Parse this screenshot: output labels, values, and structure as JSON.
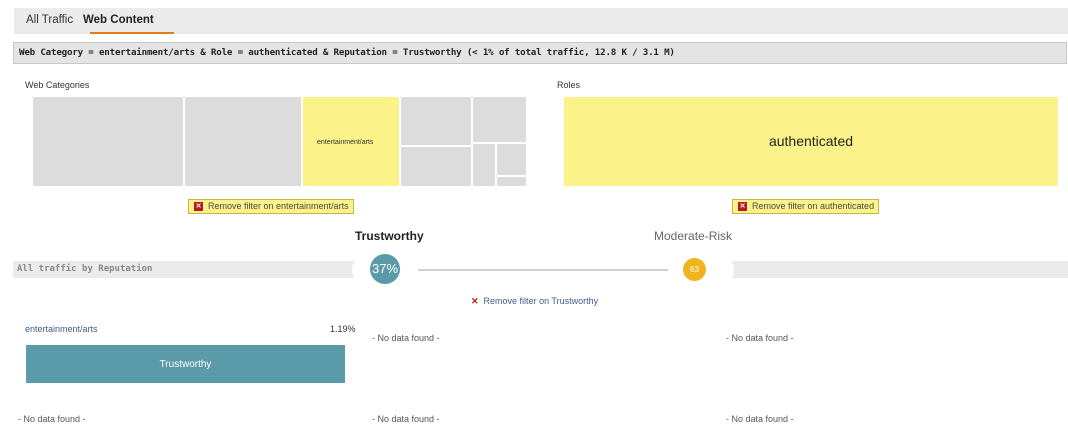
{
  "tabs": [
    {
      "label": "All Traffic",
      "active": false
    },
    {
      "label": "Web Content",
      "active": true
    }
  ],
  "filter_summary": "Web Category = entertainment/arts & Role = authenticated & Reputation = Trustworthy (< 1% of total traffic, 12.8 K / 3.1 M)",
  "web_categories": {
    "title": "Web Categories",
    "selected_label": "entertainment/arts",
    "remove_filter": "Remove filter on entertainment/arts"
  },
  "roles": {
    "title": "Roles",
    "selected_label": "authenticated",
    "remove_filter": "Remove filter on authenticated"
  },
  "reputation": {
    "band_label": "All traffic by Reputation",
    "left_title": "Trustworthy",
    "left_value": "37%",
    "right_title": "Moderate-Risk",
    "right_value": "63",
    "remove_filter": "Remove filter on Trustworthy"
  },
  "results": {
    "category_link": "entertainment/arts",
    "category_percent": "1.19%",
    "bar_label": "Trustworthy",
    "bar_fraction": 1.0,
    "no_data": "- No data found -"
  },
  "colors": {
    "accent_orange": "#e07b1f",
    "selected_yellow": "#fbf389",
    "teal": "#5b9aa9",
    "amber": "#f2b41e",
    "remove_red": "#b01e1e"
  }
}
